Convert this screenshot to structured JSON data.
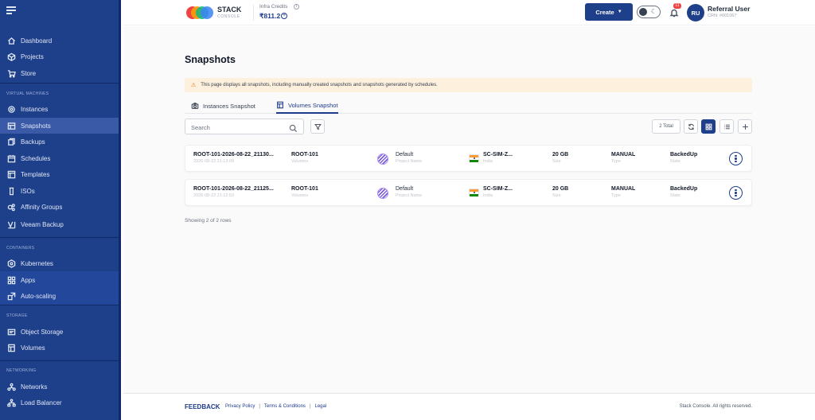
{
  "colors": {
    "sidebar": "#1e3f8a",
    "accent": "#1e3f8a",
    "notice_bg": "#fdf0dc",
    "warning": "#d97706"
  },
  "sidebar": {
    "menu_icon": "hamburger-icon",
    "top_items": [
      {
        "label": "Dashboard",
        "icon": "home-icon"
      },
      {
        "label": "Projects",
        "icon": "cube-icon"
      },
      {
        "label": "Store",
        "icon": "cart-icon"
      }
    ],
    "sections": [
      {
        "title": "VIRTUAL MACHINES",
        "items": [
          {
            "label": "Instances",
            "icon": "instance-icon"
          },
          {
            "label": "Snapshots",
            "icon": "snapshot-icon",
            "active": true
          },
          {
            "label": "Backups",
            "icon": "backup-icon"
          },
          {
            "label": "Schedules",
            "icon": "schedule-icon"
          },
          {
            "label": "Templates",
            "icon": "template-icon"
          },
          {
            "label": "ISOs",
            "icon": "iso-icon"
          },
          {
            "label": "Affinity Groups",
            "icon": "affinity-icon"
          },
          {
            "label": "Veeam Backup",
            "icon": "veeam-icon"
          }
        ]
      },
      {
        "title": "CONTAINERS",
        "items": [
          {
            "label": "Kubernetes",
            "icon": "kubernetes-icon"
          },
          {
            "label": "Apps",
            "icon": "apps-icon"
          },
          {
            "label": "Auto-scaling",
            "icon": "autoscaling-icon"
          }
        ]
      },
      {
        "title": "STORAGE",
        "items": [
          {
            "label": "Object Storage",
            "icon": "object-storage-icon"
          },
          {
            "label": "Volumes",
            "icon": "volume-icon"
          }
        ]
      },
      {
        "title": "NETWORKING",
        "items": [
          {
            "label": "Networks",
            "icon": "network-icon"
          },
          {
            "label": "Load Balancer",
            "icon": "load-balancer-icon"
          }
        ]
      }
    ]
  },
  "header": {
    "brand": "STACK",
    "brand_sub": "CONSOLE",
    "credits_label": "Infra Credits",
    "credits_value": "₹811.2",
    "create_label": "Create",
    "notification_count": "11",
    "user_initials": "RU",
    "user_name": "Referral User",
    "user_crn": "CRN: #001067"
  },
  "page": {
    "title": "Snapshots",
    "notice": "This page displays all snapshots, including manually created snapshots and snapshots generated by schedules.",
    "tabs": [
      {
        "label": "Instances Snapshot",
        "active": false
      },
      {
        "label": "Volumes Snapshot",
        "active": true
      }
    ],
    "search_placeholder": "Search",
    "total": "2 Total",
    "rows": [
      {
        "name": "ROOT-101-2026-08-22_21130...",
        "date": "2026-08-22 21:13:09",
        "volume": "ROOT-101",
        "volume_sub": "Volumes",
        "project": "Default",
        "project_sub": "Project Name",
        "zone": "SC-SIM-Z...",
        "zone_sub": "India",
        "size": "20 GB",
        "size_sub": "Size",
        "type": "MANUAL",
        "type_sub": "Type",
        "state": "BackedUp",
        "state_sub": "State"
      },
      {
        "name": "ROOT-101-2026-08-22_21125...",
        "date": "2026-08-22 21:12:53",
        "volume": "ROOT-101",
        "volume_sub": "Volumes",
        "project": "Default",
        "project_sub": "Project Name",
        "zone": "SC-SIM-Z...",
        "zone_sub": "India",
        "size": "20 GB",
        "size_sub": "Size",
        "type": "MANUAL",
        "type_sub": "Type",
        "state": "BackedUp",
        "state_sub": "State"
      }
    ],
    "showing": "Showing 2 of 2 rows"
  },
  "footer": {
    "feedback": "FEEDBACK",
    "links": [
      "Privacy Policy",
      "Terms & Conditions",
      "Legal"
    ],
    "copyright": "Stack Console. All rights reserved."
  }
}
